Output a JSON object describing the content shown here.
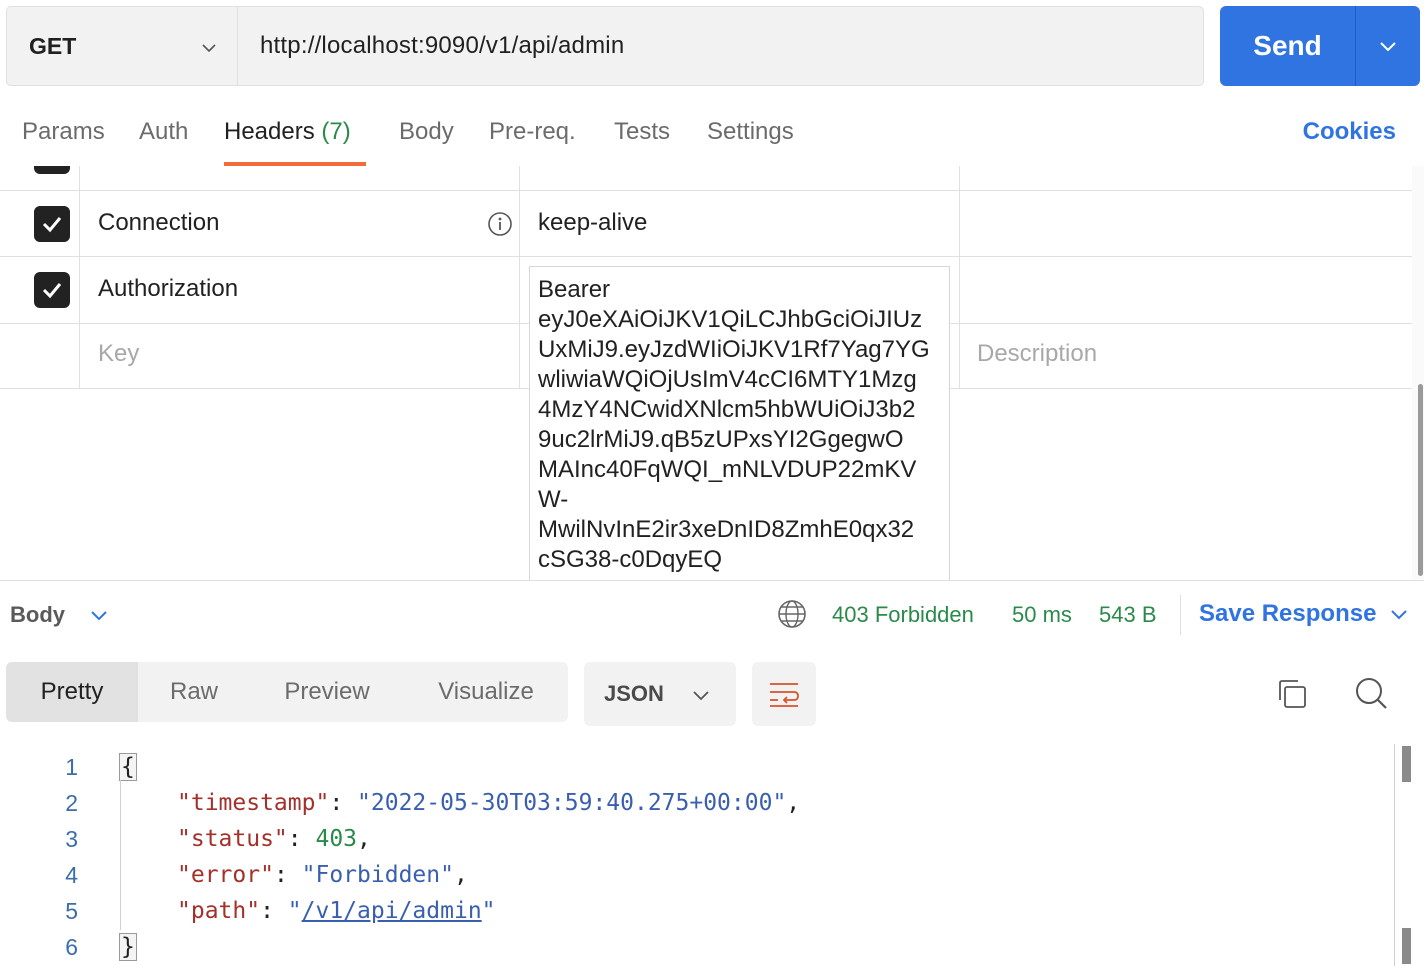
{
  "request": {
    "method": "GET",
    "url": "http://localhost:9090/v1/api/admin",
    "send_label": "Send"
  },
  "tabs": {
    "params": "Params",
    "auth": "Auth",
    "headers": "Headers",
    "headers_count": "(7)",
    "body": "Body",
    "prereq": "Pre-req.",
    "tests": "Tests",
    "settings": "Settings",
    "cookies": "Cookies"
  },
  "headers_table": {
    "rows": [
      {
        "key": "Connection",
        "value": "keep-alive",
        "checked": true
      },
      {
        "key": "Authorization",
        "value": "Bearer eyJ0eXAiOiJKV1QiLCJhbGciOiJIUzUxMiJ9.eyJzdWIiOiJKV1Rf7Yag7YGwliwiaWQiOjUsImV4cCI6MTY1Mzg4MzY4NCwidXNlcm5hbWUiOiJ3b29uc2lrMiJ9.qB5zUPxsYI2GgegwOMAInc40FqWQI_mNLVDUP22mKVW-MwilNvInE2ir3xeDnID8ZmhE0qx32cSG38-c0DqyEQ",
        "checked": true
      }
    ],
    "key_placeholder": "Key",
    "description_placeholder": "Description",
    "auth_display": "Bearer\neyJ0eXAiOiJKV1QiLCJhbGciOiJIUz\nUxMiJ9.eyJzdWIiOiJKV1Rf7Yag7YG\nwliwiaWQiOjUsImV4cCI6MTY1Mzg\n4MzY4NCwidXNlcm5hbWUiOiJ3b2\n9uc2lrMiJ9.qB5zUPxsYI2GgegwO\nMAInc40FqWQI_mNLVDUP22mKV\nW-\nMwilNvInE2ir3xeDnID8ZmhE0qx32\ncSG38-c0DqyEQ"
  },
  "response": {
    "body_label": "Body",
    "status": "403 Forbidden",
    "time": "50 ms",
    "size": "543 B",
    "save_label": "Save Response",
    "views": [
      "Pretty",
      "Raw",
      "Preview",
      "Visualize"
    ],
    "active_view": "Pretty",
    "language": "JSON",
    "colors": {
      "success": "#2a8a4a",
      "accent": "#2f74e0",
      "tab_underline": "#f26b3a"
    }
  },
  "code": {
    "line_numbers": [
      "1",
      "2",
      "3",
      "4",
      "5",
      "6"
    ],
    "open_brace": "{",
    "close_brace": "}",
    "fields": [
      {
        "key": "\"timestamp\"",
        "value": "\"2022-05-30T03:59:40.275+00:00\"",
        "trail": ","
      },
      {
        "key": "\"status\"",
        "value": "403",
        "trail": ","
      },
      {
        "key": "\"error\"",
        "value": "\"Forbidden\"",
        "trail": ","
      },
      {
        "key": "\"path\"",
        "value": "/v1/api/admin",
        "trail": ""
      }
    ]
  },
  "icons": {
    "method_dropdown": "chevron-down-icon",
    "send_dropdown": "chevron-down-icon",
    "info": "info-icon",
    "globe": "globe-icon",
    "wrap": "wrap-lines-icon",
    "copy": "copy-icon",
    "search": "search-icon"
  }
}
